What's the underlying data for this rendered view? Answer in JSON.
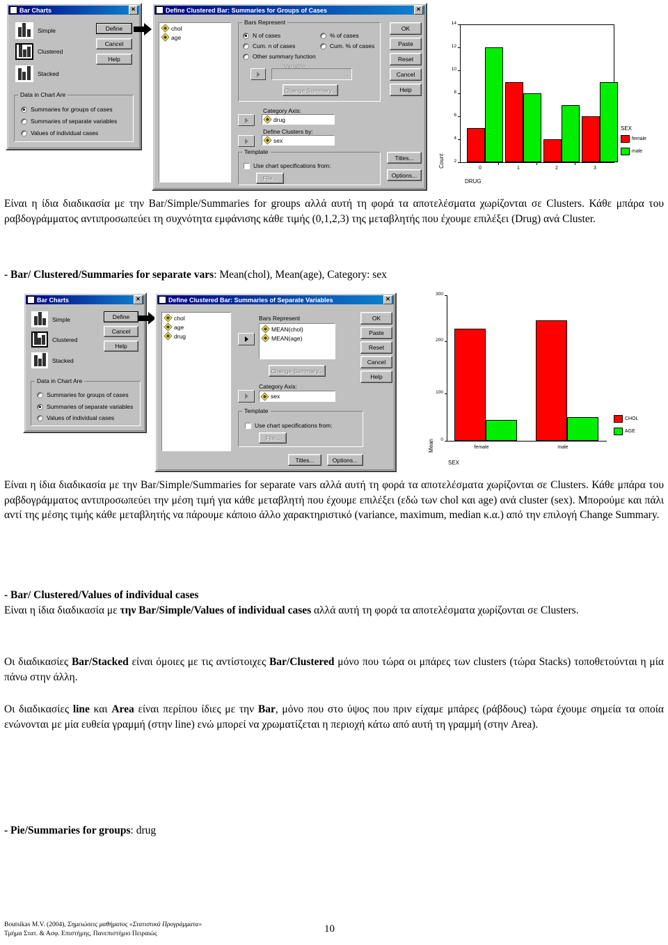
{
  "figure1": {
    "bar_charts_dialog": {
      "title": "Bar Charts",
      "close_label": "✕",
      "types": [
        {
          "label": "Simple",
          "selected": false
        },
        {
          "label": "Clustered",
          "selected": true
        },
        {
          "label": "Stacked",
          "selected": false
        }
      ],
      "buttons": [
        {
          "label": "Define",
          "default": true
        },
        {
          "label": "Cancel",
          "default": false
        },
        {
          "label": "Help",
          "default": false
        }
      ],
      "group_title": "Data in Chart Are",
      "options": [
        {
          "label": "Summaries for groups of cases",
          "selected": true
        },
        {
          "label": "Summaries of separate variables",
          "selected": false
        },
        {
          "label": "Values of individual cases",
          "selected": false
        }
      ]
    },
    "define_dialog": {
      "title": "Define Clustered Bar: Summaries for Groups of Cases",
      "close_label": "✕",
      "variables": [
        "chol",
        "age"
      ],
      "bars_represent": {
        "group_title": "Bars Represent",
        "options": [
          {
            "label": "N of cases",
            "selected": true
          },
          {
            "label": "% of cases",
            "selected": false
          },
          {
            "label": "Cum. n of cases",
            "selected": false
          },
          {
            "label": "Cum. % of cases",
            "selected": false
          },
          {
            "label": "Other summary function",
            "selected": false
          }
        ],
        "variable_label": "Variable:",
        "variable_value": "",
        "change_summary_label": "Change Summary..."
      },
      "category_axis_label": "Category Axis:",
      "category_axis_value": "drug",
      "define_clusters_label": "Define Clusters by:",
      "define_clusters_value": "sex",
      "template": {
        "group_title": "Template",
        "checkbox_label": "Use chart specifications from:",
        "checked": false,
        "file_button": "File..."
      },
      "buttons": [
        "OK",
        "Paste",
        "Reset",
        "Cancel",
        "Help"
      ],
      "titles_button": "Titles...",
      "options_button": "Options..."
    }
  },
  "figure2": {
    "bar_charts_dialog": {
      "title": "Bar Charts",
      "close_label": "✕",
      "types": [
        {
          "label": "Simple",
          "selected": false
        },
        {
          "label": "Clustered",
          "selected": true
        },
        {
          "label": "Stacked",
          "selected": false
        }
      ],
      "buttons": [
        {
          "label": "Define",
          "default": true
        },
        {
          "label": "Cancel",
          "default": false
        },
        {
          "label": "Help",
          "default": false
        }
      ],
      "group_title": "Data in Chart Are",
      "options": [
        {
          "label": "Summaries for groups of cases",
          "selected": false
        },
        {
          "label": "Summaries of separate variables",
          "selected": true
        },
        {
          "label": "Values of individual cases",
          "selected": false
        }
      ]
    },
    "define_dialog": {
      "title": "Define Clustered Bar: Summaries of Separate Variables",
      "close_label": "✕",
      "variables": [
        "chol",
        "age",
        "drug"
      ],
      "bars_represent_label": "Bars Represent",
      "bars_represent_items": [
        "MEAN(chol)",
        "MEAN(age)"
      ],
      "change_summary_label": "Change Summary...",
      "category_axis_label": "Category Axis:",
      "category_axis_value": "sex",
      "template": {
        "group_title": "Template",
        "checkbox_label": "Use chart specifications from:",
        "checked": false,
        "file_button": "File..."
      },
      "buttons": [
        "OK",
        "Paste",
        "Reset",
        "Cancel",
        "Help"
      ],
      "titles_button": "Titles...",
      "options_button": "Options..."
    }
  },
  "chart_data": [
    {
      "type": "bar",
      "title": "",
      "categories": [
        "0",
        "1",
        "2",
        "3"
      ],
      "series": [
        {
          "name": "female",
          "values": [
            5,
            9,
            4,
            6
          ],
          "color": "#ff0000"
        },
        {
          "name": "male",
          "values": [
            12,
            8,
            7,
            9
          ],
          "color": "#00ee00"
        }
      ],
      "xlabel": "DRUG",
      "ylabel": "Count",
      "ylim": [
        2,
        14
      ],
      "yticks": [
        2,
        4,
        6,
        8,
        10,
        12,
        14
      ],
      "legend_title": "SEX",
      "legend_position": "right",
      "grid": false,
      "frame": true
    },
    {
      "type": "bar",
      "title": "",
      "categories": [
        "female",
        "male"
      ],
      "series": [
        {
          "name": "CHOL",
          "values": [
            230,
            247
          ],
          "color": "#ff0000"
        },
        {
          "name": "AGE",
          "values": [
            43,
            49
          ],
          "color": "#00ee00"
        }
      ],
      "xlabel": "SEX",
      "ylabel": "Mean",
      "ylim": [
        0,
        300
      ],
      "yticks": [
        0,
        100,
        200,
        300
      ],
      "legend_title": "",
      "legend_position": "right",
      "grid": false,
      "frame": false
    }
  ],
  "text": {
    "para1_part1": "Είναι η ίδια διαδικασία με την Bar/Simple/Summaries for groups αλλά αυτή τη φορά τα αποτελέσματα χωρίζονται σε Clusters. Κάθε μπάρα του ραβδογράμματος αντιπροσωπεύει τη συχνότητα εμφάνισης κάθε τιμής (0,1,2,3) της μεταβλητής που έχουμε επιλέξει (Drug) ανά Cluster.",
    "head2_bold": "- Bar/ Clustered/Summaries for separate vars",
    "head2_rest": ": Mean(chol), Mean(age), Category: sex",
    "para2": "Είναι η ίδια διαδικασία με την Bar/Simple/Summaries for separate vars αλλά αυτή τη φορά τα αποτελέσματα χωρίζονται σε Clusters. Κάθε μπάρα του ραβδογράμματος αντιπροσωπεύει την μέση τιμή για κάθε μεταβλητή που έχουμε επιλέξει (εδώ των chol και age) ανά cluster (sex). Μπορούμε και πάλι αντί της μέσης τιμής κάθε μεταβλητής να πάρουμε κάποιο άλλο χαρακτηριστικό (variance, maximum, median κ.α.) από την επιλογή Change Summary.",
    "head3": "- Bar/ Clustered/Values of individual cases",
    "para3_a": "Είναι η ίδια διαδικασία με ",
    "para3_b": "την Bar/Simple/Values of individual cases",
    "para3_c": " αλλά αυτή τη φορά τα αποτελέσματα χωρίζονται σε Clusters.",
    "para4_a": "Οι διαδικασίες ",
    "para4_b": "Bar/Stacked",
    "para4_c": " είναι όμοιες με τις αντίστοιχες ",
    "para4_d": "Bar/Clustered",
    "para4_e": " μόνο που τώρα οι μπάρες των clusters (τώρα Stacks) τοποθετούνται η μία πάνω στην άλλη.",
    "para5_a": "Οι διαδικασίες ",
    "para5_b": "line",
    "para5_c": " και ",
    "para5_d": "Area",
    "para5_e": " είναι περίπου ίδιες με την ",
    "para5_f": "Bar",
    "para5_g": ", μόνο που στο ύψος που πριν είχαμε μπάρες (ράβδους) τώρα έχουμε σημεία τα οποία ενώνονται με μία ευθεία γραμμή (στην line) ενώ μπορεί να χρωματίζεται η περιοχή κάτω από αυτή τη γραμμή (στην Area).",
    "head6_bold": "- Pie/Summaries for groups",
    "head6_rest": ":  drug"
  },
  "footer": {
    "line1_a": "Boutsikas M.V. (2004), ",
    "line1_b": "Σημειώσεις μαθήματος «Στατιστικά Προγράμματα»",
    "line2": "Τμήμα Στατ. & Ασφ. Επιστήμης, Πανεπιστήμιο Πειραιώς",
    "page_number": "10"
  }
}
